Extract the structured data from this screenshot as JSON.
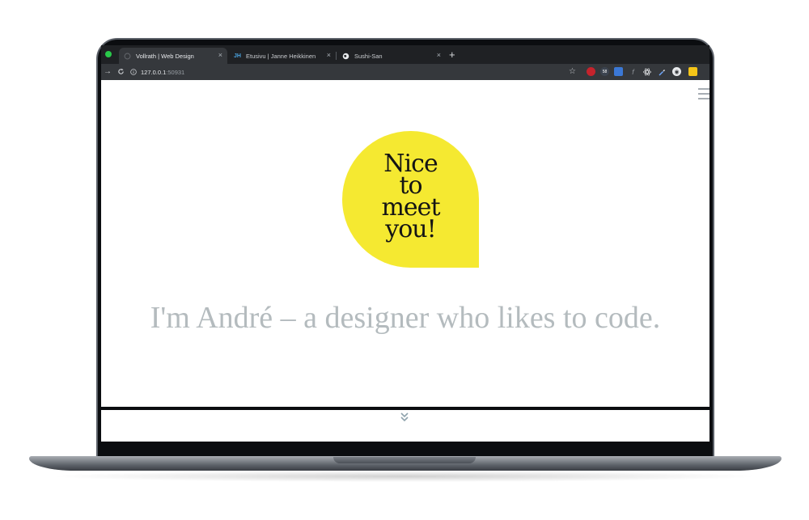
{
  "browser": {
    "tabs": [
      {
        "title": "Vollrath | Web Design",
        "favicon": "loading-icon",
        "active": true
      },
      {
        "title": "Etusivu | Janne Heikkinen",
        "favicon": "jh-logo-icon",
        "favicon_text": "JH",
        "active": false
      },
      {
        "title": "Sushi-San",
        "favicon": "globe-icon",
        "active": false
      }
    ],
    "close_glyph": "×",
    "new_tab_glyph": "+",
    "url": {
      "host": "127.0.0.1",
      "port": ":50931"
    },
    "extension_badge": "58"
  },
  "page": {
    "bubble_lines": [
      "Nice",
      "to",
      "meet",
      "you!"
    ],
    "headline": "I'm André – a designer who likes to code.",
    "accent_color": "#f5e931",
    "text_color": "#b4bbbe"
  }
}
